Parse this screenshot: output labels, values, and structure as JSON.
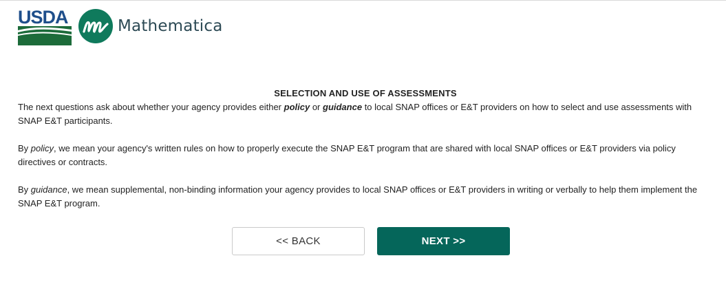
{
  "header": {
    "usda_logo_text": "USDA",
    "brand_name": "Mathematica"
  },
  "section": {
    "title": "SELECTION AND USE OF ASSESSMENTS",
    "intro": {
      "part1": "The next questions ask about whether your agency provides either ",
      "policy_word": "policy",
      "part2": " or ",
      "guidance_word": "guidance",
      "part3": " to local SNAP offices or E&T providers on how to select and use assessments with SNAP E&T participants."
    },
    "policy_def": {
      "prefix": "By ",
      "term": "policy",
      "text": ", we mean your agency's written rules on how to properly execute the SNAP E&T program that are shared with local SNAP offices or E&T providers via policy directives or contracts."
    },
    "guidance_def": {
      "prefix": "By ",
      "term": "guidance",
      "text": ", we mean supplemental, non-binding information your agency provides to local SNAP offices or E&T providers in writing or verbally to help them implement the SNAP E&T program."
    }
  },
  "buttons": {
    "back_label": "<< BACK",
    "next_label": "NEXT >>"
  },
  "colors": {
    "usda_blue": "#1f4f8b",
    "usda_green": "#1c6b3a",
    "mathematica_teal": "#0f7a5c",
    "next_button": "#05665a"
  }
}
